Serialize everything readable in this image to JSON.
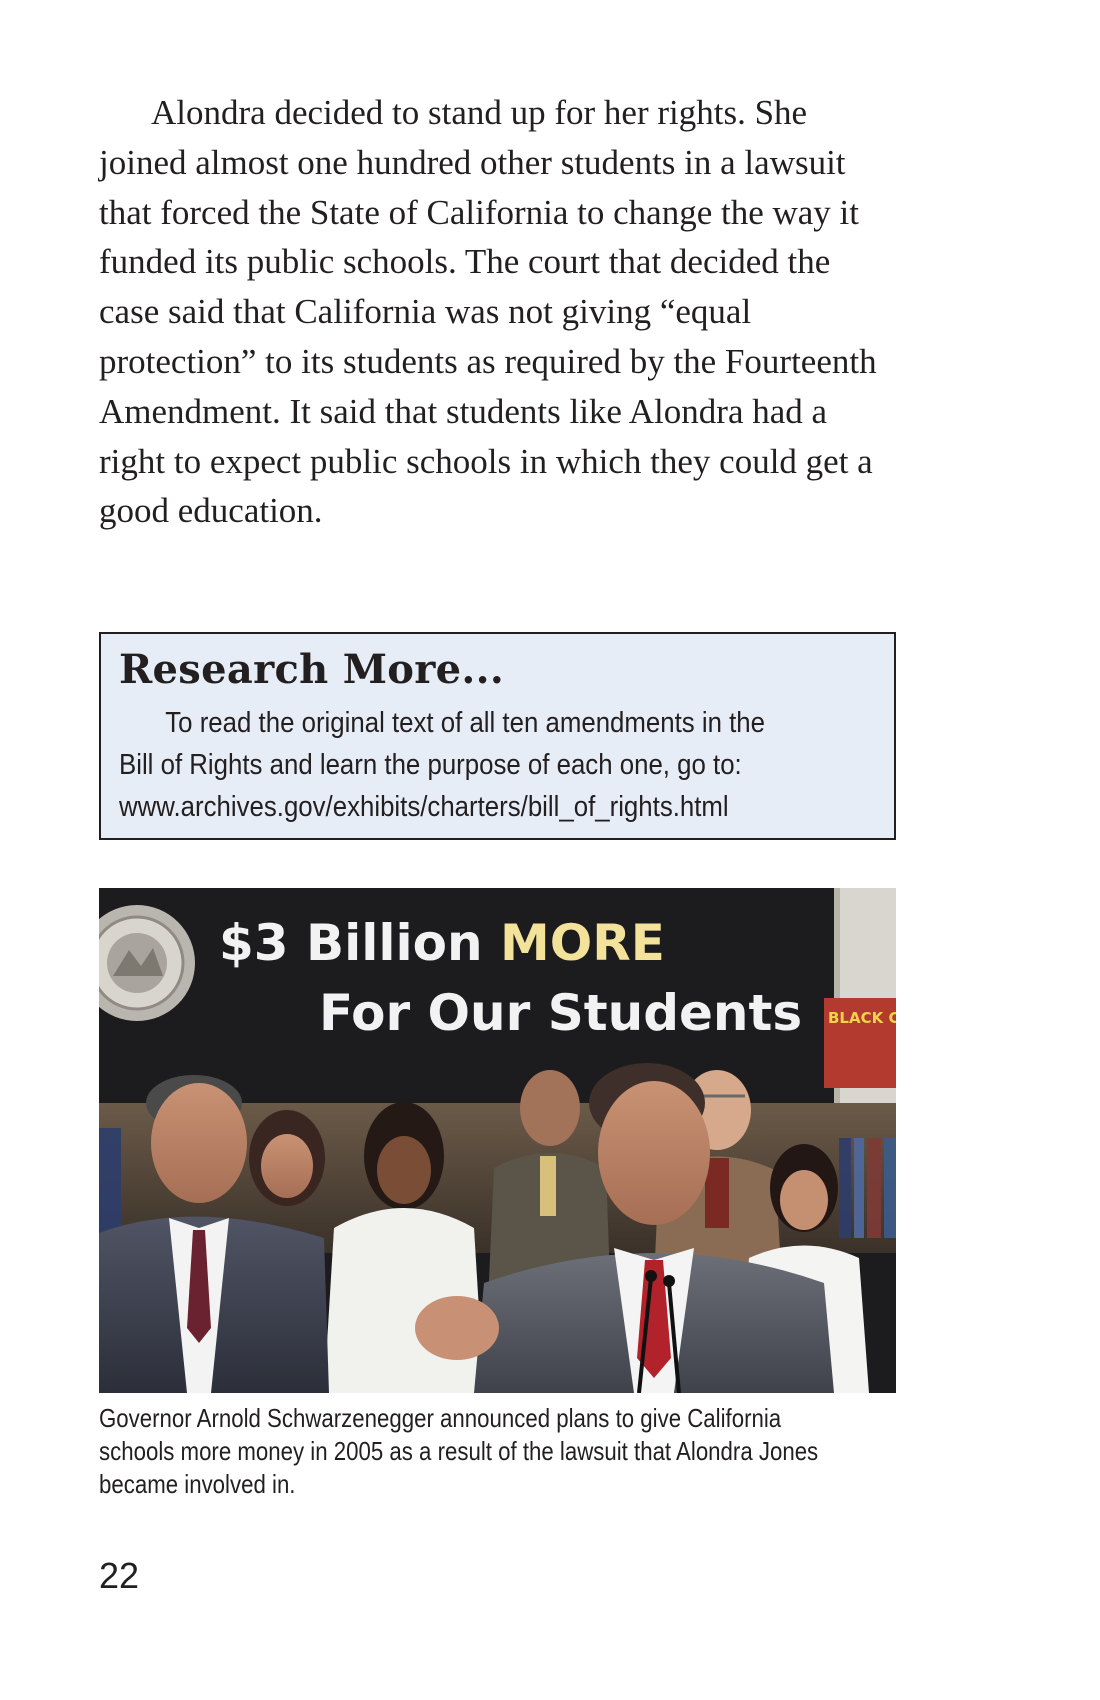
{
  "body_paragraph": "Alondra decided to stand up for her rights. She joined almost one hundred other students in a lawsuit that forced the State of California to change the way it funded its public schools. The court that decided the case said that California was not giving “equal protection” to its students as required by the Fourteenth Amendment. It said that students like Alondra had a right to expect public schools in which they could get a good education.",
  "research_box": {
    "title": "Research More...",
    "text_line_1": "To read the original text of all ten amendments in the",
    "text_line_2": "Bill of Rights and learn the purpose of each one, go to:",
    "url": "www.archives.gov/exhibits/charters/bill_of_rights.html"
  },
  "photo": {
    "banner_line_1_white": "$3 Billion",
    "banner_line_1_yellow": "MORE",
    "banner_line_2": "For Our Students",
    "book_spine_text": "BLACK CAT",
    "colors": {
      "banner_background": "#1c1b1d",
      "banner_white_text": "#f2f2f2",
      "banner_yellow_text": "#f3e29a"
    }
  },
  "caption": {
    "line_1": "Governor Arnold Schwarzenegger announced plans to give California",
    "line_2": "schools more money in 2005 as a result of the lawsuit that Alondra Jones",
    "line_3": "became involved in."
  },
  "page_number": "22"
}
